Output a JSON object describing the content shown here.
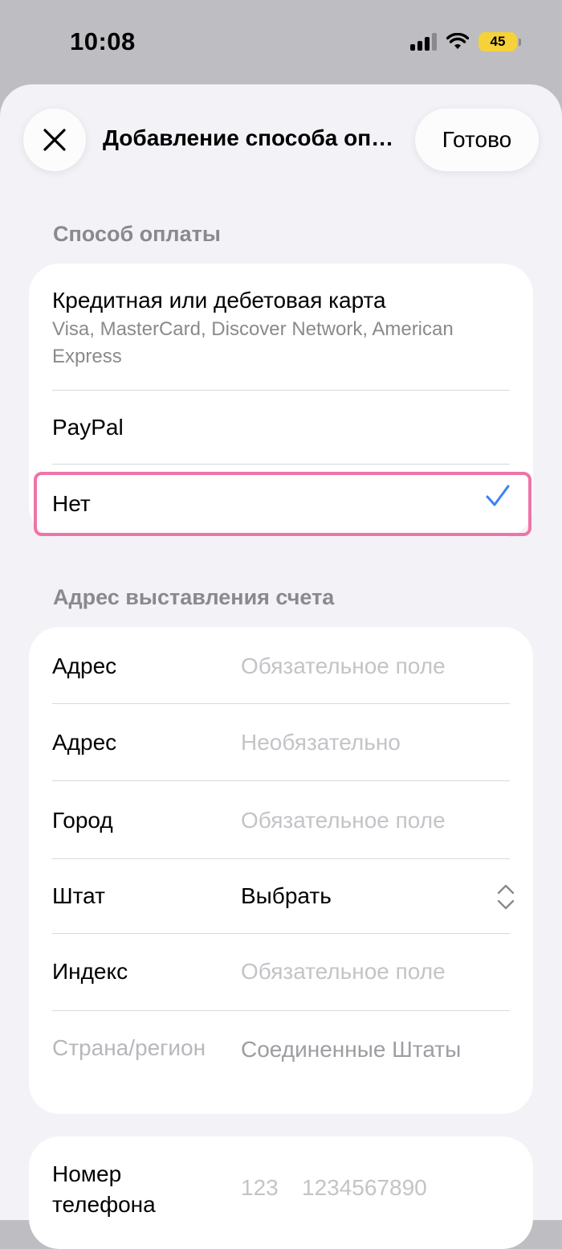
{
  "status_bar": {
    "time": "10:08",
    "battery_level": "45",
    "icons": [
      "cellular-signal-icon",
      "wifi-icon",
      "battery-icon"
    ],
    "battery_color": "#f5d23a"
  },
  "nav": {
    "title": "Добавление способа оплаты",
    "done_label": "Готово",
    "close_icon": "close-icon"
  },
  "payment_section": {
    "header": "Способ оплаты",
    "options": [
      {
        "title": "Кредитная или дебетовая карта",
        "subtitle": "Visa, MasterCard, Discover Network, American Express",
        "selected": false
      },
      {
        "title": "PayPal",
        "selected": false
      },
      {
        "title": "Нет",
        "selected": true
      }
    ],
    "check_icon": "checkmark-icon",
    "check_color": "#3a82f7"
  },
  "billing_section": {
    "header": "Адрес выставления счета",
    "fields": [
      {
        "label": "Адрес",
        "placeholder": "Обязательное поле"
      },
      {
        "label": "Адрес",
        "placeholder": "Необязательно"
      },
      {
        "label": "Город",
        "placeholder": "Обязательное поле"
      },
      {
        "label": "Штат",
        "value": "Выбрать",
        "icon": "chevron-up-down-icon"
      },
      {
        "label": "Индекс",
        "placeholder": "Обязательное поле"
      },
      {
        "label": "Страна/регион",
        "value": "Соединенные Штаты"
      }
    ]
  },
  "phone_section": {
    "label": "Номер телефона",
    "placeholder_code": "123",
    "placeholder_number": "1234567890"
  },
  "highlight_color": "#ef74a8"
}
